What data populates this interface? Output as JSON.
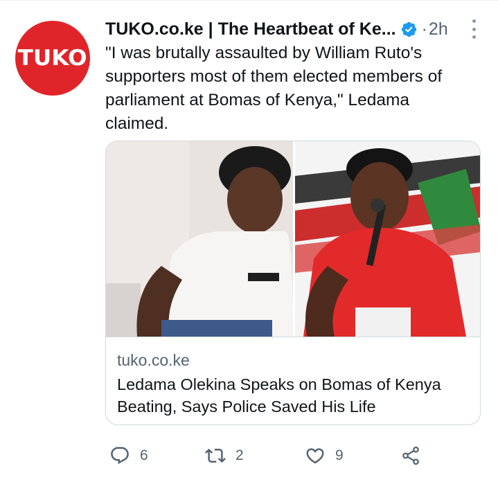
{
  "tweet": {
    "avatar_text": "TUKO",
    "author_name": "TUKO.co.ke | The Heartbeat of Ke...",
    "separator": "·",
    "time": "2h",
    "text": "\"I was brutally assaulted by William Ruto's supporters most of them elected members of parliament at Bomas of Kenya,\" Ledama claimed."
  },
  "card": {
    "domain": "tuko.co.ke",
    "title": "Ledama Olekina Speaks on Bomas of Kenya Beating, Says Police Saved His Life"
  },
  "actions": {
    "replies": "6",
    "retweets": "2",
    "likes": "9"
  },
  "colors": {
    "brand_red": "#e0252a",
    "verified_blue": "#1d9bf0",
    "muted": "#536471"
  },
  "icons": [
    "verified-badge-icon",
    "more-options-icon",
    "reply-icon",
    "retweet-icon",
    "like-icon",
    "share-icon"
  ]
}
